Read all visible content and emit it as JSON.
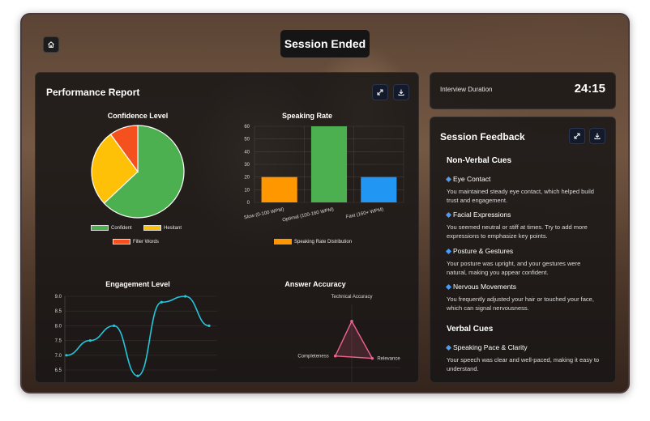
{
  "header": {
    "title": "Session Ended"
  },
  "report": {
    "title": "Performance Report",
    "confidence": {
      "title": "Confidence Level",
      "legend": [
        "Confident",
        "Hesitant",
        "Filler Words"
      ]
    },
    "speaking": {
      "title": "Speaking Rate",
      "legend": "Speaking Rate Distribution"
    },
    "engagement": {
      "title": "Engagement Level"
    },
    "accuracy": {
      "title": "Answer Accuracy"
    }
  },
  "duration": {
    "label": "Interview Duration",
    "value": "24:15"
  },
  "feedback": {
    "title": "Session Feedback",
    "nonverbal_title": "Non-Verbal Cues",
    "items": [
      {
        "heading": "Eye Contact",
        "body": "You maintained steady eye contact, which helped build trust and engagement."
      },
      {
        "heading": "Facial Expressions",
        "body": "You seemed neutral or stiff at times. Try to add more expressions to emphasize key points."
      },
      {
        "heading": "Posture & Gestures",
        "body": "Your posture was upright, and your gestures were natural, making you appear confident."
      },
      {
        "heading": "Nervous Movements",
        "body": "You frequently adjusted your hair or touched your face, which can signal nervousness."
      }
    ],
    "verbal_title": "Verbal Cues",
    "verbal_items": [
      {
        "heading": "Speaking Pace & Clarity",
        "body": "Your speech was clear and well-paced, making it easy to understand."
      }
    ]
  },
  "colors": {
    "green": "#4caf50",
    "yellow": "#ffc107",
    "red": "#f4511e",
    "orange": "#ff9800",
    "blue": "#2196f3",
    "teal": "#26c6da",
    "pink": "#f06292"
  },
  "chart_data": [
    {
      "type": "pie",
      "title": "Confidence Level",
      "categories": [
        "Confident",
        "Hesitant",
        "Filler Words"
      ],
      "values": [
        63,
        27,
        10
      ],
      "colors": [
        "#4caf50",
        "#ffc107",
        "#f4511e"
      ],
      "legend": "bottom"
    },
    {
      "type": "bar",
      "title": "Speaking Rate",
      "categories": [
        "Slow (0-100 WPM)",
        "Optimal (100-160 WPM)",
        "Fast (160+ WPM)"
      ],
      "values": [
        20,
        60,
        20
      ],
      "colors": [
        "#ff9800",
        "#4caf50",
        "#2196f3"
      ],
      "yticks": [
        "0",
        "10",
        "20",
        "30",
        "40",
        "50",
        "60"
      ],
      "ylim": [
        0,
        60
      ],
      "series": [
        {
          "name": "Speaking Rate Distribution",
          "values": [
            20,
            60,
            20
          ]
        }
      ],
      "grid": true,
      "legend": "bottom"
    },
    {
      "type": "line",
      "title": "Engagement Level",
      "x": [
        0,
        1,
        2,
        3,
        4,
        5,
        6
      ],
      "values": [
        7.0,
        7.5,
        8.0,
        6.3,
        8.8,
        9.0,
        8.0
      ],
      "yticks": [
        "6.5",
        "7.0",
        "7.5",
        "8.0",
        "8.5",
        "9.0"
      ],
      "ylim": [
        6.5,
        9.0
      ],
      "grid": true
    },
    {
      "type": "radar",
      "title": "Answer Accuracy",
      "categories": [
        "Technical Accuracy",
        "Relevance",
        "Completeness"
      ],
      "values": [
        80,
        75,
        60
      ],
      "range": [
        0,
        100
      ]
    }
  ]
}
